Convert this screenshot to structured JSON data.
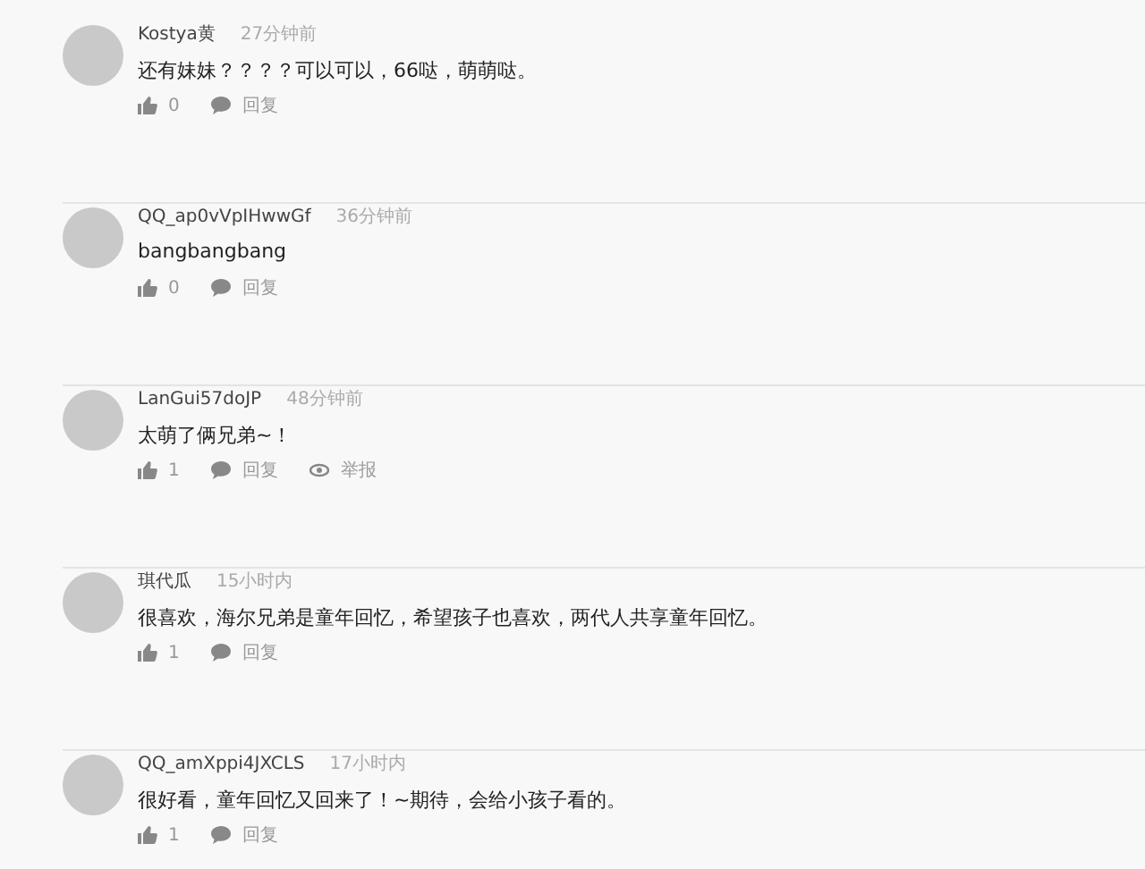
{
  "comments": [
    {
      "author": "Kostya黄",
      "time": "27分钟前",
      "text": "还有妹妹？？？？可以可以，66哒，萌萌哒。",
      "actions": [
        {
          "kind": "like",
          "label": "0"
        },
        {
          "kind": "reply",
          "label": "回复"
        }
      ]
    },
    {
      "author": "QQ_ap0vVpIHwwGf",
      "time": "36分钟前",
      "text": "bangbangbang",
      "actions": [
        {
          "kind": "like",
          "label": "0"
        },
        {
          "kind": "reply",
          "label": "回复"
        }
      ]
    },
    {
      "author": "LanGui57doJP",
      "time": "48分钟前",
      "text": "太萌了俩兄弟~！",
      "actions": [
        {
          "kind": "like",
          "label": "1"
        },
        {
          "kind": "reply",
          "label": "回复"
        },
        {
          "kind": "report",
          "label": "举报"
        }
      ]
    },
    {
      "author": "琪代瓜",
      "time": "15小时内",
      "text": "很喜欢，海尔兄弟是童年回忆，希望孩子也喜欢，两代人共享童年回忆。",
      "actions": [
        {
          "kind": "like",
          "label": "1"
        },
        {
          "kind": "reply",
          "label": "回复"
        }
      ]
    },
    {
      "author": "QQ_amXppi4JXCLS",
      "time": "17小时内",
      "text": "很好看，童年回忆又回来了！~期待，会给小孩子看的。",
      "actions": [
        {
          "kind": "like",
          "label": "1"
        },
        {
          "kind": "reply",
          "label": "回复"
        }
      ]
    }
  ]
}
